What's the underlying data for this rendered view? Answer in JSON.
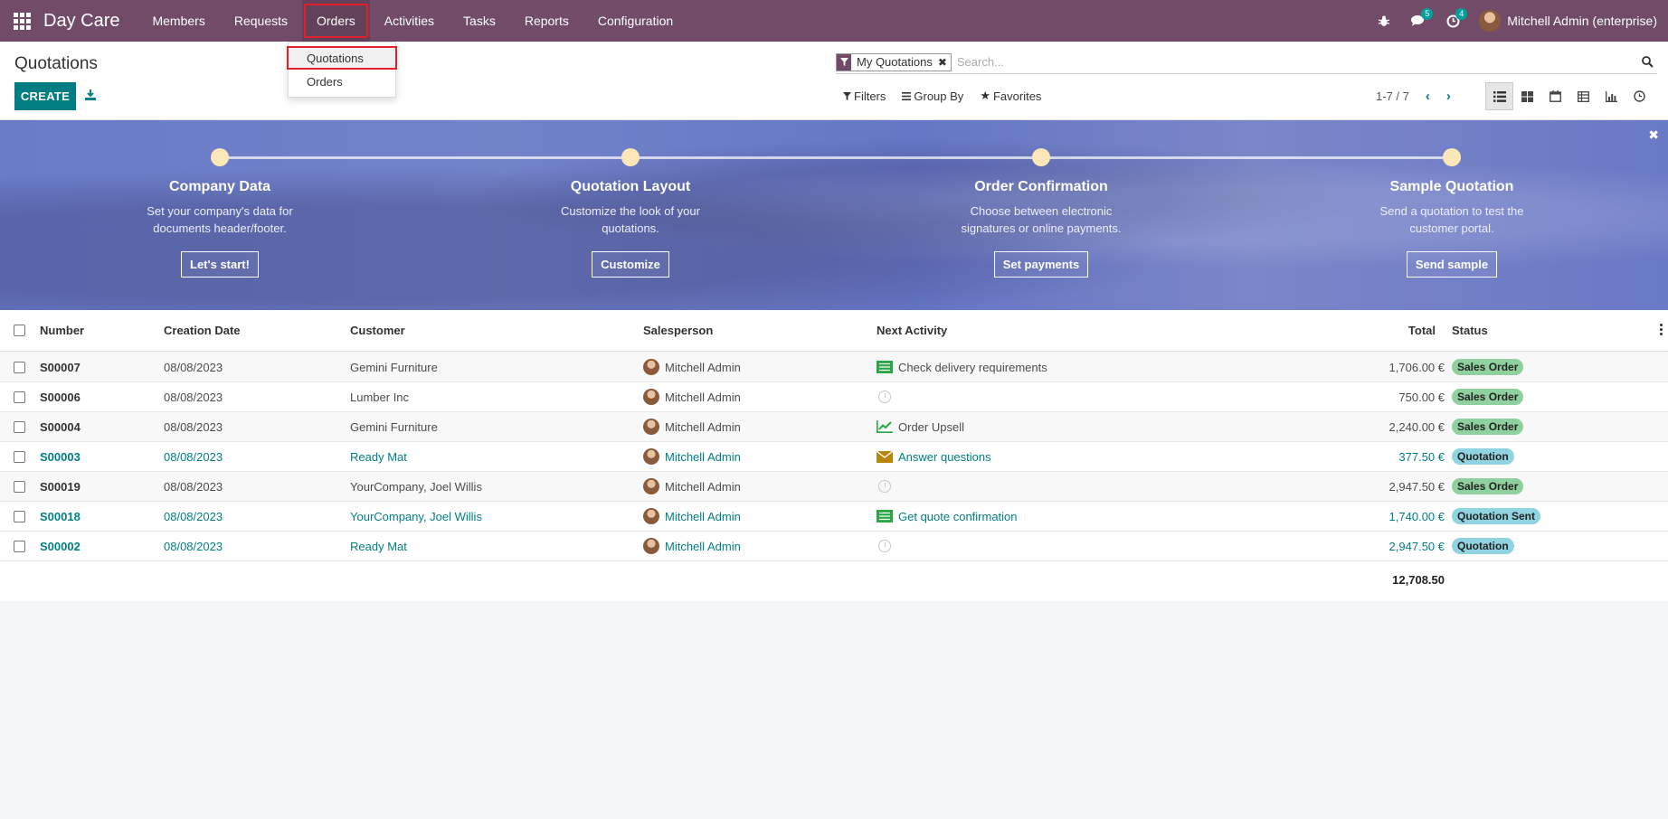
{
  "navbar": {
    "brand": "Day Care",
    "menu": [
      "Members",
      "Requests",
      "Orders",
      "Activities",
      "Tasks",
      "Reports",
      "Configuration"
    ],
    "messages_count": "5",
    "activities_count": "4",
    "user": "Mitchell Admin (enterprise)"
  },
  "dropdown": {
    "items": [
      "Quotations",
      "Orders"
    ]
  },
  "control_panel": {
    "title": "Quotations",
    "create_label": "CREATE",
    "facet": "My Quotations",
    "search_placeholder": "Search...",
    "filters": "Filters",
    "group_by": "Group By",
    "favorites": "Favorites",
    "pager": "1-7 / 7"
  },
  "banner": {
    "steps": [
      {
        "title": "Company Data",
        "desc": "Set your company's data for documents header/footer.",
        "button": "Let's start!"
      },
      {
        "title": "Quotation Layout",
        "desc": "Customize the look of your quotations.",
        "button": "Customize"
      },
      {
        "title": "Order Confirmation",
        "desc": "Choose between electronic signatures or online payments.",
        "button": "Set payments"
      },
      {
        "title": "Sample Quotation",
        "desc": "Send a quotation to test the customer portal.",
        "button": "Send sample"
      }
    ]
  },
  "table": {
    "headers": {
      "number": "Number",
      "date": "Creation Date",
      "customer": "Customer",
      "salesperson": "Salesperson",
      "activity": "Next Activity",
      "total": "Total",
      "status": "Status"
    },
    "rows": [
      {
        "number": "S00007",
        "date": "08/08/2023",
        "customer": "Gemini Furniture",
        "salesperson": "Mitchell Admin",
        "activity": "Check delivery requirements",
        "total": "1,706.00 €",
        "status": "Sales Order"
      },
      {
        "number": "S00006",
        "date": "08/08/2023",
        "customer": "Lumber Inc",
        "salesperson": "Mitchell Admin",
        "activity": "",
        "total": "750.00 €",
        "status": "Sales Order"
      },
      {
        "number": "S00004",
        "date": "08/08/2023",
        "customer": "Gemini Furniture",
        "salesperson": "Mitchell Admin",
        "activity": "Order Upsell",
        "total": "2,240.00 €",
        "status": "Sales Order"
      },
      {
        "number": "S00003",
        "date": "08/08/2023",
        "customer": "Ready Mat",
        "salesperson": "Mitchell Admin",
        "activity": "Answer questions",
        "total": "377.50 €",
        "status": "Quotation"
      },
      {
        "number": "S00019",
        "date": "08/08/2023",
        "customer": "YourCompany, Joel Willis",
        "salesperson": "Mitchell Admin",
        "activity": "",
        "total": "2,947.50 €",
        "status": "Sales Order"
      },
      {
        "number": "S00018",
        "date": "08/08/2023",
        "customer": "YourCompany, Joel Willis",
        "salesperson": "Mitchell Admin",
        "activity": "Get quote confirmation",
        "total": "1,740.00 €",
        "status": "Quotation Sent"
      },
      {
        "number": "S00002",
        "date": "08/08/2023",
        "customer": "Ready Mat",
        "salesperson": "Mitchell Admin",
        "activity": "",
        "total": "2,947.50 €",
        "status": "Quotation"
      }
    ],
    "grand_total": "12,708.50"
  },
  "colors": {
    "brand": "#714b67",
    "primary": "#017e84",
    "sales_order_badge": "#8fd19e",
    "quotation_badge": "#8fd4e0"
  }
}
